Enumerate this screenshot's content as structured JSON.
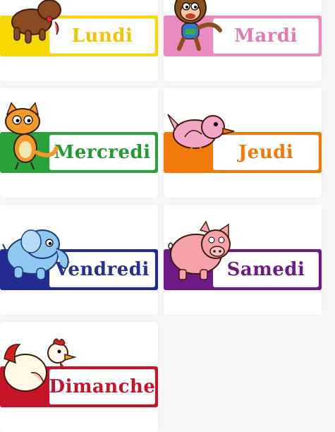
{
  "cards": [
    {
      "day": "Lundi",
      "animal": "dog-icon",
      "banner_color": "#f6d900",
      "text_color": "#f2c400"
    },
    {
      "day": "Mardi",
      "animal": "monkey-icon",
      "banner_color": "#e98bbf",
      "text_color": "#e07bb4"
    },
    {
      "day": "Mercredi",
      "animal": "cat-icon",
      "banner_color": "#2aa23a",
      "text_color": "#1f9b35"
    },
    {
      "day": "Jeudi",
      "animal": "bird-icon",
      "banner_color": "#f07a08",
      "text_color": "#f07a08"
    },
    {
      "day": "Vendredi",
      "animal": "elephant-icon",
      "banner_color": "#242a8f",
      "text_color": "#2b2f8f"
    },
    {
      "day": "Samedi",
      "animal": "pig-icon",
      "banner_color": "#6b1a86",
      "text_color": "#6b1a86"
    },
    {
      "day": "Dimanche",
      "animal": "rooster-icon",
      "banner_color": "#c61426",
      "text_color": "#c61426"
    }
  ]
}
